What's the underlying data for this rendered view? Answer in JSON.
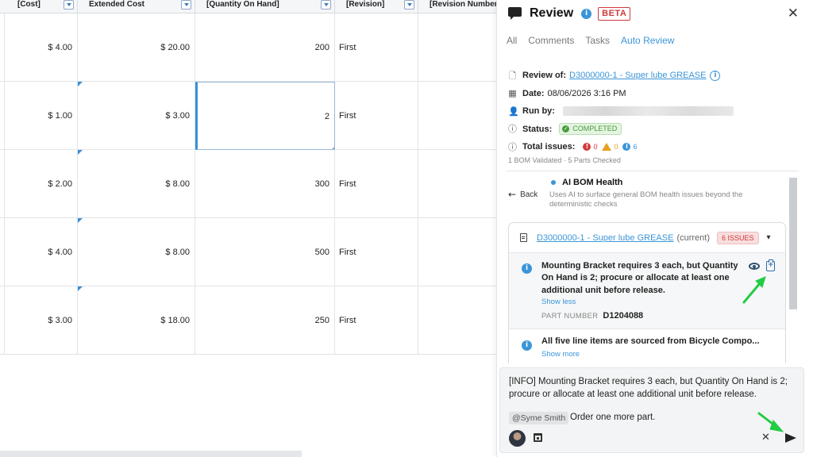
{
  "sheet": {
    "columns": [
      "[Cost]",
      "Extended Cost",
      "[Quantity On Hand]",
      "[Revision]",
      "[Revision Number"
    ],
    "rows": [
      {
        "cost": "$ 4.00",
        "extended": "$ 20.00",
        "qty": "200",
        "revision": "First"
      },
      {
        "cost": "$ 1.00",
        "extended": "$ 3.00",
        "qty": "2",
        "revision": "First"
      },
      {
        "cost": "$ 2.00",
        "extended": "$ 8.00",
        "qty": "300",
        "revision": "First"
      },
      {
        "cost": "$ 4.00",
        "extended": "$ 8.00",
        "qty": "500",
        "revision": "First"
      },
      {
        "cost": "$ 3.00",
        "extended": "$ 18.00",
        "qty": "250",
        "revision": "First"
      }
    ]
  },
  "panel": {
    "title": "Review",
    "info_glyph": "i",
    "beta": "BETA",
    "close": "✕",
    "tabs": [
      "All",
      "Comments",
      "Tasks",
      "Auto Review"
    ],
    "active_tab": "Auto Review",
    "review_of_label": "Review of:",
    "review_of_value": "D3000000-1 - Super lube GREASE",
    "date_label": "Date:",
    "date_value": "08/06/2026 3:16 PM",
    "run_by_label": "Run by:",
    "status_label": "Status:",
    "status_value": "COMPLETED",
    "total_label": "Total issues:",
    "errors": "0",
    "warnings": "0",
    "infos": "6",
    "summary": "1 BOM Validated · 5 Parts Checked",
    "back": "Back",
    "check_title": "AI BOM Health",
    "check_desc": "Uses AI to surface general BOM health issues beyond the deterministic checks",
    "card_link": "D3000000-1 - Super lube GREASE",
    "card_current": "(current)",
    "card_badge": "6 ISSUES",
    "issue1_text": "Mounting Bracket requires 3 each, but Quantity On Hand is 2; procure or allocate at least one additional unit before release.",
    "show_less": "Show less",
    "part_number_label": "PART NUMBER",
    "part_number": "D1204088",
    "issue2_text": "All five line items are sourced from Bicycle Compo...",
    "show_more": "Show more"
  },
  "composer": {
    "text": "[INFO] Mounting Bracket requires 3 each, but Quantity On Hand is 2; procure or allocate at least one additional unit before release.",
    "mention": "@Syme Smith",
    "reply": "Order one more part.",
    "cancel": "✕"
  },
  "colors": {
    "accent": "#3b95d8",
    "error": "#d23a3a",
    "warning": "#e8a11f",
    "success": "#4a9b3e",
    "annotation_arrow": "#22cc44"
  }
}
